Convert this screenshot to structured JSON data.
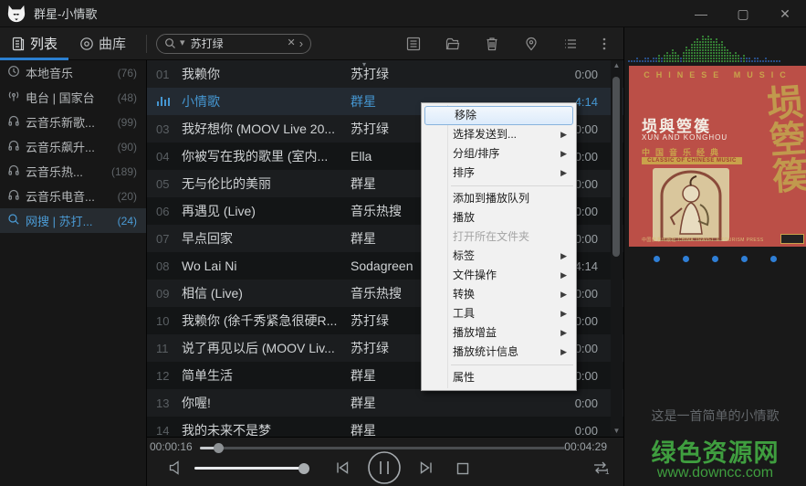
{
  "window": {
    "title": "群星-小情歌",
    "minimize": "—",
    "maximize": "▢",
    "close": "✕"
  },
  "toolbar": {
    "tabs": [
      {
        "label": "列表",
        "active": true
      },
      {
        "label": "曲库",
        "active": false
      }
    ],
    "search": {
      "value": "苏打绿",
      "clear": "✕",
      "expand": "›"
    },
    "icons": [
      "playlist-doc",
      "folder",
      "trash",
      "location-pin",
      "queue-list",
      "more-kebab"
    ]
  },
  "sidebar": {
    "items": [
      {
        "icon": "clock",
        "label": "本地音乐",
        "count": "(76)",
        "selected": false
      },
      {
        "icon": "radio",
        "label": "电台 | 国家台",
        "count": "(48)",
        "selected": false
      },
      {
        "icon": "headphones",
        "label": "云音乐新歌...",
        "count": "(99)",
        "selected": false
      },
      {
        "icon": "headphones",
        "label": "云音乐飙升...",
        "count": "(90)",
        "selected": false
      },
      {
        "icon": "headphones",
        "label": "云音乐热...",
        "count": "(189)",
        "selected": false
      },
      {
        "icon": "headphones",
        "label": "云音乐电音...",
        "count": "(20)",
        "selected": false
      },
      {
        "icon": "search",
        "label": "网搜 | 苏打...",
        "count": "(24)",
        "selected": true
      }
    ]
  },
  "playlist": {
    "rows": [
      {
        "num": "01",
        "title": "我赖你",
        "artist": "苏打绿",
        "duration": "0:00",
        "playing": false
      },
      {
        "num": "02",
        "title": "小情歌",
        "artist": "群星",
        "duration": "4:14",
        "playing": true
      },
      {
        "num": "03",
        "title": "我好想你 (MOOV Live 20...",
        "artist": "苏打绿",
        "duration": "0:00",
        "playing": false
      },
      {
        "num": "04",
        "title": "你被写在我的歌里 (室内...",
        "artist": "Ella",
        "duration": "0:00",
        "playing": false
      },
      {
        "num": "05",
        "title": "无与伦比的美丽",
        "artist": "群星",
        "duration": "0:00",
        "playing": false
      },
      {
        "num": "06",
        "title": "再遇见 (Live)",
        "artist": "音乐热搜",
        "duration": "0:00",
        "playing": false
      },
      {
        "num": "07",
        "title": "早点回家",
        "artist": "群星",
        "duration": "0:00",
        "playing": false
      },
      {
        "num": "08",
        "title": "Wo Lai Ni",
        "artist": "Sodagreen",
        "duration": "4:14",
        "playing": false
      },
      {
        "num": "09",
        "title": "相信 (Live)",
        "artist": "音乐热搜",
        "duration": "0:00",
        "playing": false
      },
      {
        "num": "10",
        "title": "我赖你 (徐千秀紧急很硬R...",
        "artist": "苏打绿",
        "duration": "0:00",
        "playing": false
      },
      {
        "num": "11",
        "title": "说了再见以后 (MOOV Liv...",
        "artist": "苏打绿",
        "duration": "0:00",
        "playing": false
      },
      {
        "num": "12",
        "title": "简单生活",
        "artist": "群星",
        "duration": "0:00",
        "playing": false
      },
      {
        "num": "13",
        "title": "你喔!",
        "artist": "群星",
        "duration": "0:00",
        "playing": false
      },
      {
        "num": "14",
        "title": "我的未来不是梦",
        "artist": "群星",
        "duration": "0:00",
        "playing": false
      }
    ]
  },
  "context_menu": {
    "items": [
      {
        "label": "移除",
        "highlighted": true
      },
      {
        "label": "选择发送到...",
        "submenu": true
      },
      {
        "label": "分组/排序",
        "submenu": true
      },
      {
        "label": "排序",
        "submenu": true
      },
      {
        "separator": true
      },
      {
        "label": "添加到播放队列"
      },
      {
        "label": "播放"
      },
      {
        "label": "打开所在文件夹",
        "disabled": true
      },
      {
        "label": "标签",
        "submenu": true
      },
      {
        "label": "文件操作",
        "submenu": true
      },
      {
        "label": "转换",
        "submenu": true
      },
      {
        "label": "工具",
        "submenu": true
      },
      {
        "label": "播放增益",
        "submenu": true
      },
      {
        "label": "播放统计信息",
        "submenu": true
      },
      {
        "separator": true
      },
      {
        "label": "属性"
      }
    ]
  },
  "right_panel": {
    "spectrum": [
      1,
      1,
      1,
      2,
      1,
      1,
      2,
      2,
      1,
      2,
      2,
      3,
      2,
      3,
      4,
      3,
      5,
      4,
      3,
      2,
      4,
      6,
      5,
      7,
      8,
      9,
      8,
      10,
      9,
      10,
      9,
      8,
      9,
      7,
      8,
      6,
      5,
      4,
      3,
      4,
      3,
      2,
      3,
      2,
      2,
      1,
      2,
      2,
      1,
      1,
      2,
      1,
      1,
      1,
      1,
      1
    ],
    "album": {
      "header": "CHINESE MUSIC",
      "title_cn": "埙與箜篌",
      "title_en": "XUN AND KONGHOU",
      "strip_cn": "中国音乐经典",
      "strip_en": "CLASSIC OF CHINESE MUSIC",
      "calligraphy": "埙箜篌",
      "footer": "中国旅游出版社  CHINA TRAVEL & TOURISM PRESS"
    },
    "pager_dots": 5,
    "lyric": "这是一首简单的小情歌",
    "watermark": {
      "line1": "绿色资源网",
      "line2": "www.downcc.com"
    }
  },
  "player": {
    "elapsed": "00:00:16",
    "total": "00:04:29",
    "progress_pct": 5,
    "volume_pct": 96
  },
  "colors": {
    "accent_blue": "#4596d1",
    "tab_underline": "#2b7fd0",
    "menu_highlight_border": "#88b3dd",
    "watermark_green": "#3f9e3f",
    "album_red": "#bb4f47",
    "album_gold": "#c9a24b",
    "spectrum_green": "#3e9c3e",
    "spectrum_blue": "#2d5fa8"
  }
}
